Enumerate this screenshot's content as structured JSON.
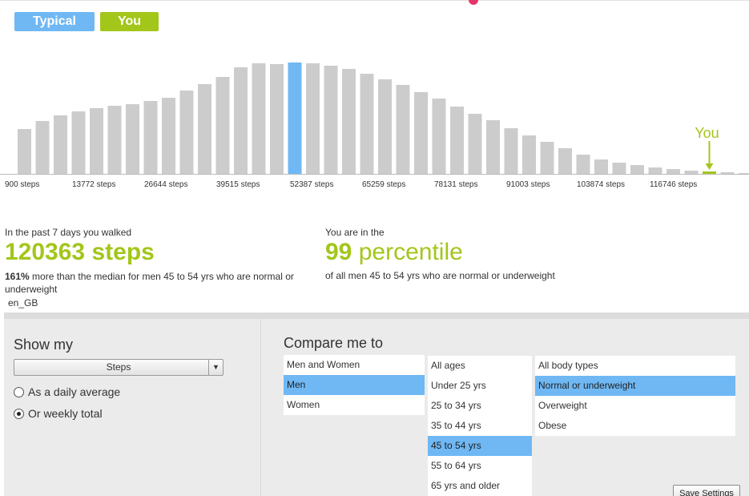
{
  "legend": {
    "typical_label": "Typical",
    "you_label": "You"
  },
  "colors": {
    "typical": "#6fb8f4",
    "you": "#a3c61a",
    "bar": "#cccccc",
    "marker": "#e8336b"
  },
  "chart_data": {
    "type": "bar",
    "xlabel": "",
    "ylabel": "",
    "tick_labels": [
      "900 steps",
      "13772 steps",
      "26644 steps",
      "39515 steps",
      "52387 steps",
      "65259 steps",
      "78131 steps",
      "91003 steps",
      "103874 steps",
      "116746 steps"
    ],
    "values": [
      56,
      66,
      73,
      78,
      82,
      85,
      87,
      91,
      95,
      104,
      112,
      121,
      133,
      138,
      137,
      139,
      138,
      135,
      131,
      125,
      118,
      111,
      102,
      94,
      84,
      75,
      67,
      57,
      48,
      40,
      32,
      24,
      18,
      14,
      11,
      8,
      6,
      4,
      3,
      2,
      1,
      1
    ],
    "highlight_typical_index": 15,
    "highlight_you_index": 38,
    "you_annotation": "You"
  },
  "stats": {
    "left_intro": "In the past 7 days you walked",
    "left_value": "120363",
    "left_unit": "steps",
    "left_pct": "161%",
    "left_desc": " more than the median for men 45 to 54 yrs who are normal or underweight",
    "locale": "en_GB",
    "right_intro": "You are in the",
    "right_value": "99",
    "right_unit": "percentile",
    "right_desc": "of all men 45 to 54 yrs who are normal or underweight"
  },
  "show_my": {
    "title": "Show my",
    "select_value": "Steps",
    "options": [
      {
        "label": "As a daily average",
        "checked": false
      },
      {
        "label": "Or weekly total",
        "checked": true
      }
    ]
  },
  "compare": {
    "title": "Compare me to",
    "genders": [
      "Men and Women",
      "Men",
      "Women"
    ],
    "gender_selected": 1,
    "ages": [
      "All ages",
      "Under 25 yrs",
      "25 to 34 yrs",
      "35 to 44 yrs",
      "45 to 54 yrs",
      "55 to 64 yrs",
      "65 yrs and older"
    ],
    "age_selected": 4,
    "body_types": [
      "All body types",
      "Normal or underweight",
      "Overweight",
      "Obese"
    ],
    "body_selected": 1
  },
  "save_label": "Save Settings"
}
